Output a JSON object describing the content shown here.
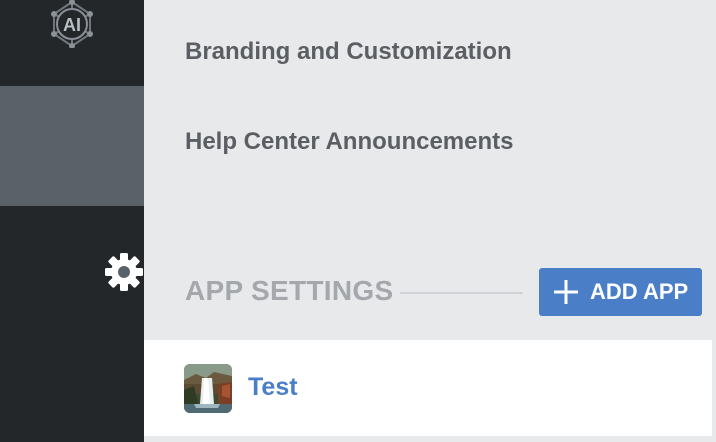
{
  "sidebar": {
    "logo_icon": "ai-network-logo-icon",
    "logo_text": "AI",
    "settings_icon": "gear-icon",
    "active_item": "settings",
    "colors": {
      "background": "#23272a",
      "active_background": "#5a6168"
    }
  },
  "settings_menu": {
    "items": [
      {
        "label": "Branding and Customization"
      },
      {
        "label": "Help Center Announcements"
      }
    ]
  },
  "app_settings": {
    "title": "APP SETTINGS",
    "add_button": {
      "icon": "plus-icon",
      "label": "ADD APP"
    },
    "apps": [
      {
        "name": "Test",
        "thumbnail": "waterfall-photo"
      }
    ]
  },
  "colors": {
    "accent": "#4a7fc7",
    "menu_text": "#5b5f63",
    "section_title": "#a4a8ad",
    "page_background": "#e8e9eb"
  }
}
